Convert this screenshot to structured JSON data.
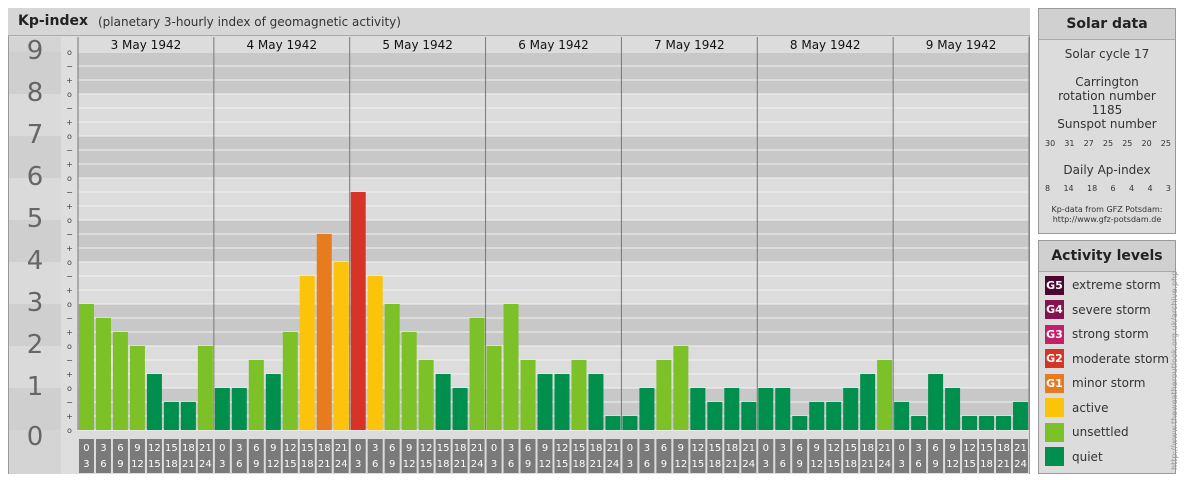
{
  "title": {
    "main": "Kp-index",
    "sub": "(planetary 3-hourly index of geomagnetic activity)"
  },
  "chart_data": {
    "type": "bar",
    "ylim": [
      0,
      9
    ],
    "y_major_ticks": [
      "0",
      "1",
      "2",
      "3",
      "4",
      "5",
      "6",
      "7",
      "8",
      "9"
    ],
    "y_minor_ticks": [
      "o",
      "+",
      "−"
    ],
    "days": [
      "3 May 1942",
      "4 May 1942",
      "5 May 1942",
      "6 May 1942",
      "7 May 1942",
      "8 May 1942",
      "9 May 1942"
    ],
    "interval_top": [
      "0",
      "3",
      "6",
      "9",
      "12",
      "15",
      "18",
      "21"
    ],
    "interval_bottom": [
      "3",
      "6",
      "9",
      "12",
      "15",
      "18",
      "21",
      "24"
    ],
    "values": [
      3.0,
      2.667,
      2.333,
      2.0,
      1.333,
      0.667,
      0.667,
      2.0,
      1.0,
      1.0,
      1.667,
      1.333,
      2.333,
      3.667,
      4.667,
      4.0,
      5.667,
      3.667,
      3.0,
      2.333,
      1.667,
      1.333,
      1.0,
      2.667,
      2.0,
      3.0,
      1.667,
      1.333,
      1.333,
      1.667,
      1.333,
      0.333,
      0.333,
      1.0,
      1.667,
      2.0,
      1.0,
      0.667,
      1.0,
      0.667,
      1.0,
      1.0,
      0.333,
      0.667,
      0.667,
      1.0,
      1.333,
      1.667,
      0.667,
      0.333,
      1.333,
      1.0,
      0.333,
      0.333,
      0.333,
      0.667
    ],
    "colors": {
      "quiet": "#008f4c",
      "unsettled": "#7cc128",
      "active": "#fbc30a",
      "G1": "#e87b1e",
      "G2": "#d63427",
      "G3": "#c2206b",
      "G4": "#86134f",
      "G5": "#4d0531"
    }
  },
  "solar": {
    "heading": "Solar data",
    "cycle": "Solar cycle 17",
    "carrington": "Carrington rotation number 1185",
    "sunspot_label": "Sunspot number",
    "sunspot_values": [
      "30",
      "31",
      "27",
      "25",
      "25",
      "20",
      "25"
    ],
    "ap_label": "Daily Ap-index",
    "ap_values": [
      "8",
      "14",
      "18",
      "6",
      "4",
      "4",
      "3"
    ],
    "source_line1": "Kp-data from GFZ Potsdam:",
    "source_line2": "http://www.gfz-potsdam.de"
  },
  "activity": {
    "heading": "Activity levels",
    "levels": [
      {
        "badge": "G5",
        "label": "extreme storm",
        "color": "#4d0531"
      },
      {
        "badge": "G4",
        "label": "severe storm",
        "color": "#86134f"
      },
      {
        "badge": "G3",
        "label": "strong storm",
        "color": "#c2206b"
      },
      {
        "badge": "G2",
        "label": "moderate storm",
        "color": "#d63427"
      },
      {
        "badge": "G1",
        "label": "minor storm",
        "color": "#e87b1e"
      },
      {
        "badge": "",
        "label": "active",
        "color": "#fbc30a"
      },
      {
        "badge": "",
        "label": "unsettled",
        "color": "#7cc128"
      },
      {
        "badge": "",
        "label": "quiet",
        "color": "#008f4c"
      }
    ]
  },
  "credit": "http://www.theweatheroutlook.org.uk/archive.php"
}
